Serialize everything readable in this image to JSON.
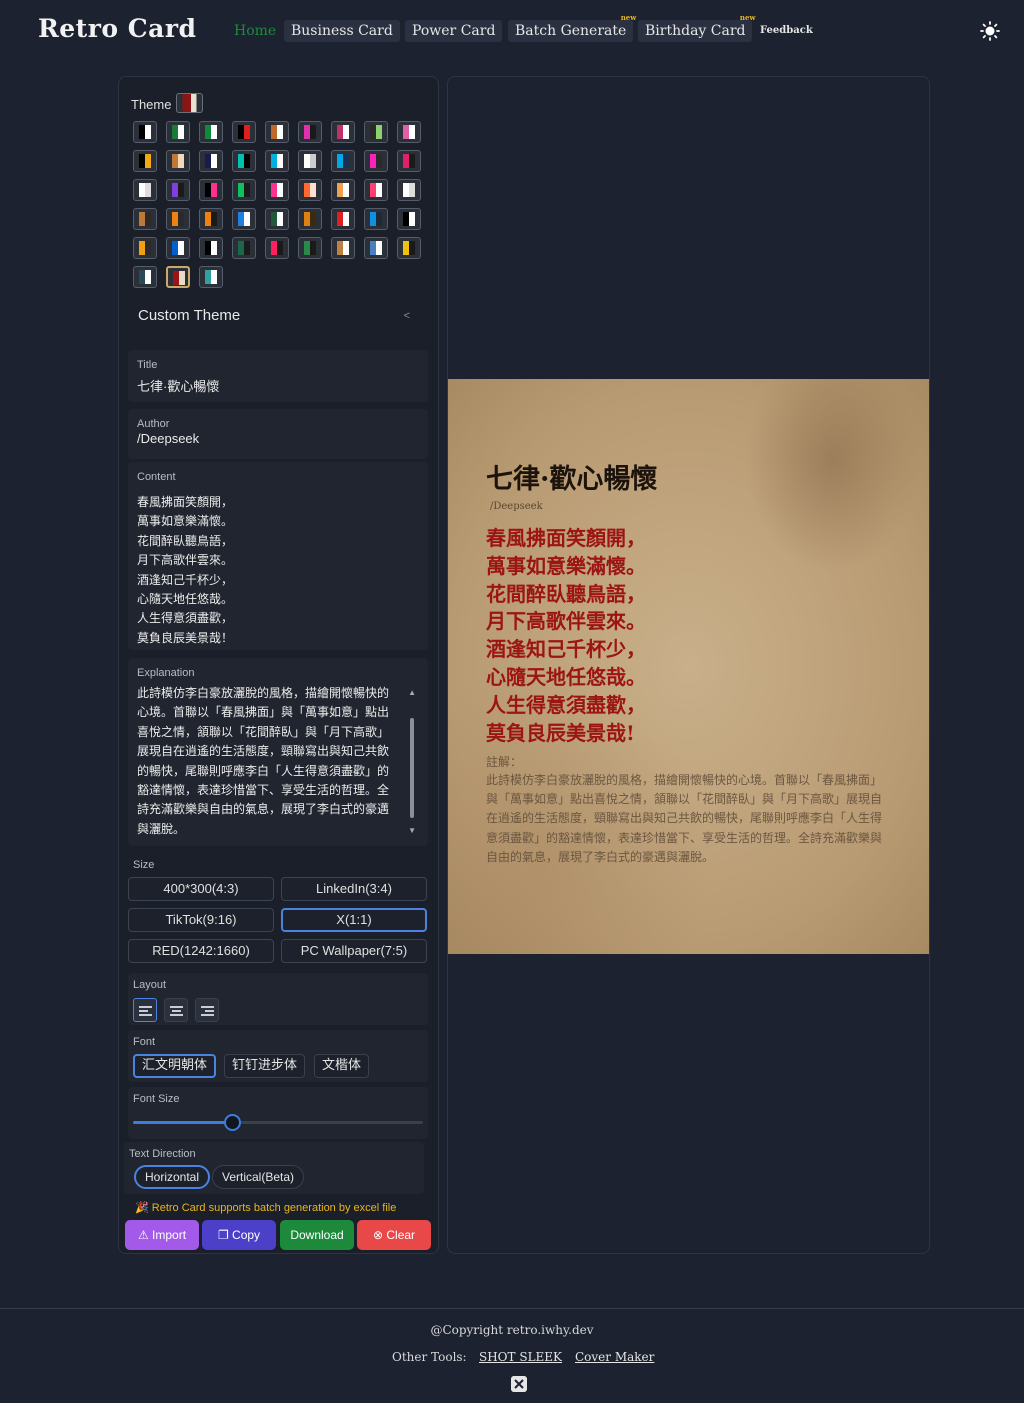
{
  "app": {
    "logo": "Retro Card",
    "nav": [
      {
        "label": "Home"
      },
      {
        "label": "Business Card"
      },
      {
        "label": "Power Card"
      },
      {
        "label": "Batch Generate",
        "badge": "new"
      },
      {
        "label": "Birthday Card",
        "badge": "new"
      },
      {
        "label": "Feedback"
      }
    ],
    "theme_toggle_icon": "sun-icon"
  },
  "theme": {
    "label": "Theme",
    "current_colors": [
      "#8b1414",
      "#e8e0d0"
    ],
    "swatches": [
      [
        "#000000",
        "#ffffff"
      ],
      [
        "#1a7a3a",
        "#ffffff"
      ],
      [
        "#0f8a3a",
        "#ffffff"
      ],
      [
        "#000000",
        "#e02020"
      ],
      [
        "#c06828",
        "#ffffff"
      ],
      [
        "#e030b0",
        "#1a1a1a"
      ],
      [
        "#c0306a",
        "#ffffff"
      ],
      [
        "#2a2a2a",
        "#8fd070"
      ],
      [
        "#e060a8",
        "#ffffff"
      ],
      [
        "#000000",
        "#f0a818"
      ],
      [
        "#c07838",
        "#f0d8b8"
      ],
      [
        "#1a1a50",
        "#ffffff"
      ],
      [
        "#00c0b0",
        "#000000"
      ],
      [
        "#00b0e0",
        "#ffffff"
      ],
      [
        "#ffffff",
        "#cccccc"
      ],
      [
        "#00a8e8",
        "#1a3050"
      ],
      [
        "#ff20c0",
        "#2a2a2a"
      ],
      [
        "#e0206a",
        "#1a1a1a"
      ],
      [
        "#ffffff",
        "#dddddd"
      ],
      [
        "#8040e0",
        "#1a1a1a"
      ],
      [
        "#000000",
        "#ff3090"
      ],
      [
        "#10c060",
        "#1a1a1a"
      ],
      [
        "#ff3090",
        "#ffffff"
      ],
      [
        "#ff6830",
        "#ffe0d0"
      ],
      [
        "#f0a050",
        "#ffffff"
      ],
      [
        "#ff4070",
        "#ffffff"
      ],
      [
        "#ffffff",
        "#dddddd"
      ],
      [
        "#c07838",
        "#2a2a2a"
      ],
      [
        "#f08010",
        "#2a2a2a"
      ],
      [
        "#f08010",
        "#1a1a1a"
      ],
      [
        "#2080e0",
        "#ffffff"
      ],
      [
        "#205a3a",
        "#ffffff"
      ],
      [
        "#e08010",
        "#3a2a10"
      ],
      [
        "#e02020",
        "#ffffff"
      ],
      [
        "#1090e0",
        "#1a2a3a"
      ],
      [
        "#000000",
        "#ffffff"
      ],
      [
        "#f0a010",
        "#2a2a2a"
      ],
      [
        "#0060d0",
        "#ffffff"
      ],
      [
        "#000000",
        "#ffffff"
      ],
      [
        "#1a6a4a",
        "#1a1a1a"
      ],
      [
        "#ff2060",
        "#1a1a1a"
      ],
      [
        "#2a8a4a",
        "#1a1a1a"
      ],
      [
        "#c08040",
        "#ffffff"
      ],
      [
        "#4a80c0",
        "#ffffff"
      ],
      [
        "#f0c010",
        "#1a1a1a"
      ],
      [
        "#2a4a5a",
        "#ffffff"
      ],
      [
        "#9c1414",
        "#e8dcc8"
      ],
      [
        "#30a0a0",
        "#ffffff"
      ]
    ],
    "selected_index": 46,
    "custom_theme_label": "Custom Theme",
    "custom_theme_chevron": "<"
  },
  "form": {
    "title_label": "Title",
    "title_value": "七律·歡心暢懷",
    "author_label": "Author",
    "author_value": "/Deepseek",
    "content_label": "Content",
    "content_lines": [
      "春風拂面笑顏開，",
      "萬事如意樂滿懷。",
      "花間醉臥聽鳥語，",
      "月下高歌伴雲來。",
      "酒逢知己千杯少，",
      "心隨天地任悠哉。",
      "人生得意須盡歡，",
      "莫負良辰美景哉！"
    ],
    "explanation_label": "Explanation",
    "explanation_value": "此詩模仿李白豪放灑脫的風格，描繪開懷暢快的心境。首聯以「春風拂面」與「萬事如意」點出喜悅之情，頷聯以「花間醉臥」與「月下高歌」展現自在逍遙的生活態度，頸聯寫出與知己共飲的暢快，尾聯則呼應李白「人生得意須盡歡」的豁達情懷，表達珍惜當下、享受生活的哲理。全詩充滿歡樂與自由的氣息，展現了李白式的豪邁與灑脫。"
  },
  "size": {
    "label": "Size",
    "options": [
      "400*300(4:3)",
      "LinkedIn(3:4)",
      "TikTok(9:16)",
      "X(1:1)",
      "RED(1242:1660)",
      "PC Wallpaper(7:5)"
    ],
    "selected": "X(1:1)"
  },
  "layout": {
    "label": "Layout",
    "options": [
      "align-left-icon",
      "align-center-icon",
      "align-right-icon"
    ],
    "selected": "align-left-icon"
  },
  "font": {
    "label": "Font",
    "options": [
      "汇文明朝体",
      "钉钉进步体",
      "文楷体"
    ],
    "selected": "汇文明朝体"
  },
  "font_size": {
    "label": "Font Size",
    "level": 0.34
  },
  "text_direction": {
    "label": "Text Direction",
    "options": [
      "Horizontal",
      "Vertical(Beta)"
    ],
    "selected": "Horizontal"
  },
  "batch_note": "🎉 Retro Card supports batch generation by excel file",
  "actions": {
    "import": {
      "label": "Import",
      "icon": "upload-icon",
      "color": "#a35ae8"
    },
    "copy": {
      "label": "Copy",
      "icon": "copy-icon",
      "color": "#4c3fc8"
    },
    "download": {
      "label": "Download",
      "color": "#1c8a3a"
    },
    "clear": {
      "label": "Clear",
      "icon": "close-circle-icon",
      "color": "#e84848"
    }
  },
  "preview": {
    "title": "七律·歡心暢懷",
    "author": "/Deepseek",
    "lines": [
      "春風拂面笑顏開，",
      "萬事如意樂滿懷。",
      "花間醉臥聽鳥語，",
      "月下高歌伴雲來。",
      "酒逢知己千杯少，",
      "心隨天地任悠哉。",
      "人生得意須盡歡，",
      "莫負良辰美景哉!"
    ],
    "explanation_label": "註解：",
    "explanation": "此詩模仿李白豪放灑脫的風格，描繪開懷暢快的心境。首聯以「春風拂面」與「萬事如意」點出喜悅之情，頷聯以「花間醉臥」與「月下高歌」展現自在逍遙的生活態度，頸聯寫出與知己共飲的暢快，尾聯則呼應李白「人生得意須盡歡」的豁達情懷，表達珍惜當下、享受生活的哲理。全詩充滿歡樂與自由的氣息，展現了李白式的豪邁與灑脫。"
  },
  "footer": {
    "copyright": "@Copyright retro.iwhy.dev",
    "other_tools_label": "Other Tools:",
    "tools": [
      "SHOT SLEEK",
      "Cover Maker"
    ],
    "social_icon": "x-twitter-icon"
  }
}
